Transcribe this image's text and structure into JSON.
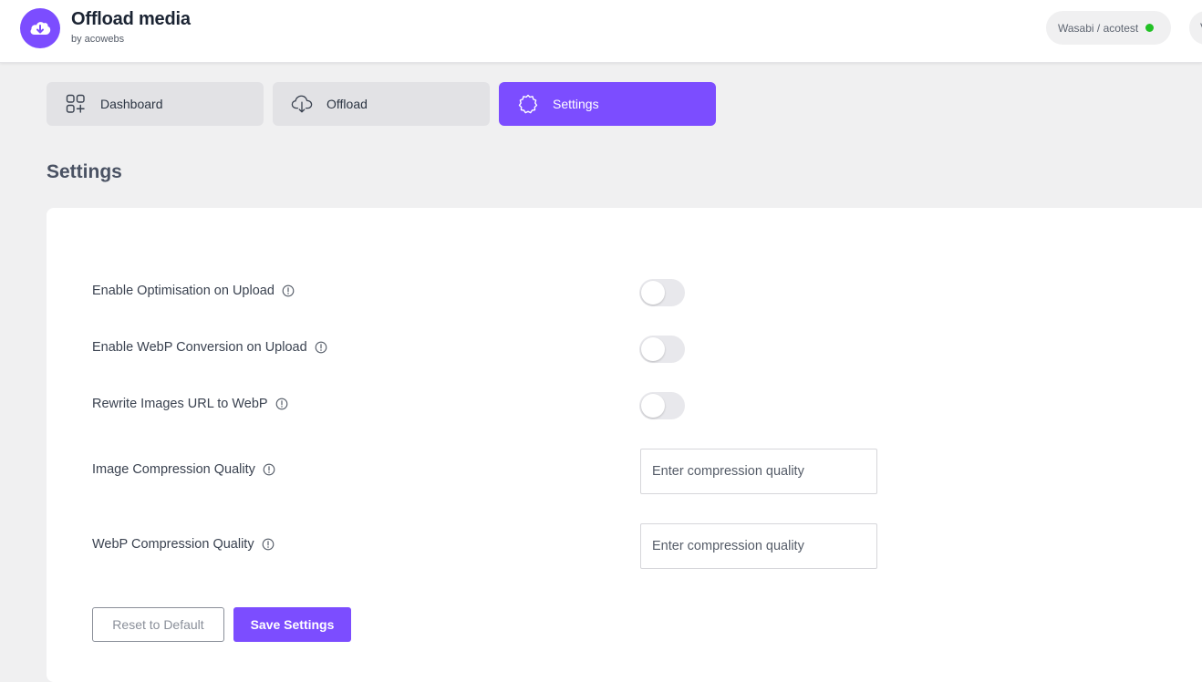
{
  "brand": {
    "title": "Offload media",
    "subtitle": "by acowebs",
    "logo_icon": "cloud-download-icon",
    "accent_color": "#7c4dff"
  },
  "connection": {
    "label": "Wasabi / acotest",
    "status_color": "#22c125",
    "next_pill_text": "V"
  },
  "tabs": [
    {
      "label": "Dashboard",
      "icon": "dashboard-grid-icon",
      "active": false
    },
    {
      "label": "Offload",
      "icon": "cloud-upload-icon",
      "active": false
    },
    {
      "label": "Settings",
      "icon": "gear-icon",
      "active": true
    }
  ],
  "page": {
    "title": "Settings"
  },
  "settings": {
    "toggles": [
      {
        "label": "Enable Optimisation on Upload",
        "enabled": false
      },
      {
        "label": "Enable WebP Conversion on Upload",
        "enabled": false
      },
      {
        "label": "Rewrite Images URL to WebP",
        "enabled": false
      }
    ],
    "inputs": [
      {
        "label": "Image Compression Quality",
        "value": "",
        "placeholder": "Enter compression quality"
      },
      {
        "label": "WebP Compression Quality",
        "value": "",
        "placeholder": "Enter compression quality"
      }
    ]
  },
  "actions": {
    "reset_label": "Reset to Default",
    "save_label": "Save Settings"
  }
}
